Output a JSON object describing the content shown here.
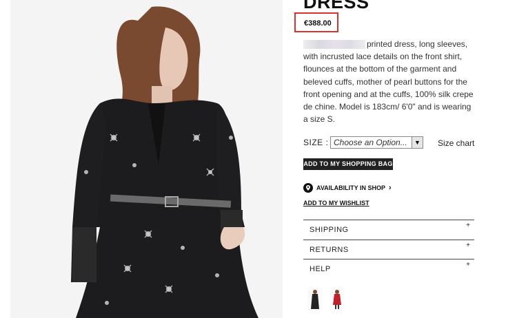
{
  "product": {
    "title": "DRESS",
    "price": "€388.00",
    "description": "printed dress, long sleeves, with incrusted lace details on the front shirt, flounces at the bottom of the garment and beleved cuffs, mother of pearl buttons for the front opening and at the cuffs, 100% silk crepe de chine. Model is 183cm/ 6'0\" and is wearing a size S."
  },
  "size": {
    "label": "SIZE :",
    "selected": "Choose an Option...",
    "chart_link": "Size chart"
  },
  "actions": {
    "add_to_bag": "ADD TO MY SHOPPING BAG",
    "availability": "AVAILABILITY IN SHOP",
    "availability_arrow": "›",
    "wishlist": "ADD TO MY WISHLIST"
  },
  "accordion": [
    {
      "label": "SHIPPING",
      "icon": "+"
    },
    {
      "label": "RETURNS",
      "icon": "+"
    },
    {
      "label": "HELP",
      "icon": "+"
    }
  ],
  "colors": {
    "price_highlight": "#d9322e",
    "button_bg": "#222222"
  }
}
